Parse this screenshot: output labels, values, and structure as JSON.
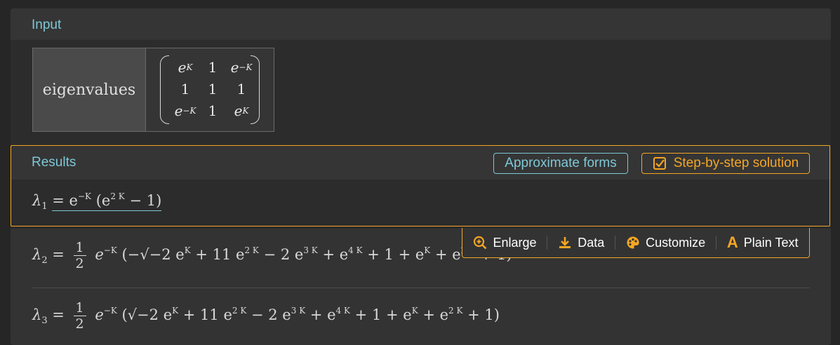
{
  "input": {
    "title": "Input",
    "label": "eigenvalues",
    "matrix": [
      [
        "e",
        "1",
        "e"
      ],
      [
        "1",
        "1",
        "1"
      ],
      [
        "e",
        "1",
        "e"
      ]
    ],
    "matrix_exp": [
      [
        "K",
        "",
        "−K"
      ],
      [
        "",
        "",
        ""
      ],
      [
        "−K",
        "",
        "K"
      ]
    ]
  },
  "results": {
    "title": "Results",
    "approx_label": "Approximate forms",
    "steps_label": "Step-by-step solution",
    "l1": {
      "lhs": "λ",
      "sub": "1",
      "expr": "= e",
      "e1": "−K",
      "paren_open": "(e",
      "e2": "2 K",
      "tail": "− 1)"
    },
    "l2": {
      "lhs": "λ",
      "sub": "2",
      "half_n": "1",
      "half_d": "2",
      "expr": "e",
      "e1": "−K",
      "body": "(−√−2 e",
      "b1": "K",
      "body2": "+ 11 e",
      "b2": "2 K",
      "body3": "− 2 e",
      "b3": "3 K",
      "body4": "+ e",
      "b4": "4 K",
      "body5": "+ 1 + e",
      "b5": "K",
      "body6": "+ e",
      "b6": "2 K",
      "body7": "+ 1)"
    },
    "l3": {
      "lhs": "λ",
      "sub": "3",
      "half_n": "1",
      "half_d": "2",
      "expr": "e",
      "e1": "−K",
      "body": "(√−2 e",
      "b1": "K",
      "body2": "+ 11 e",
      "b2": "2 K",
      "body3": "− 2 e",
      "b3": "3 K",
      "body4": "+ e",
      "b4": "4 K",
      "body5": "+ 1 + e",
      "b5": "K",
      "body6": "+ e",
      "b6": "2 K",
      "body7": "+ 1)"
    }
  },
  "toolbar": {
    "enlarge": "Enlarge",
    "data": "Data",
    "customize": "Customize",
    "plaintext": "Plain Text"
  },
  "colors": {
    "accent": "#f5a623",
    "teal": "#7ec8d6"
  }
}
